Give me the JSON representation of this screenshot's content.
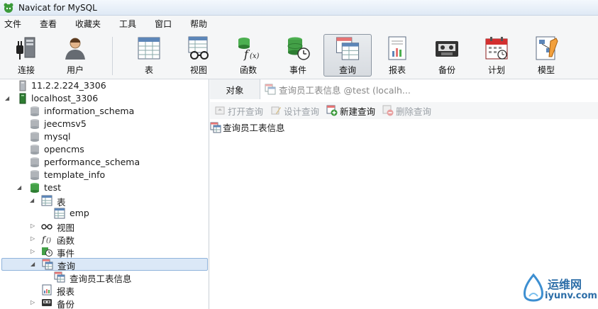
{
  "window": {
    "title": "Navicat for MySQL"
  },
  "menu": [
    "文件",
    "查看",
    "收藏夹",
    "工具",
    "窗口",
    "帮助"
  ],
  "toolbar": {
    "connect": "连接",
    "user": "用户",
    "table": "表",
    "view": "视图",
    "function": "函数",
    "event": "事件",
    "query": "查询",
    "report": "报表",
    "backup": "备份",
    "schedule": "计划",
    "model": "模型"
  },
  "tree": {
    "conn1": "11.2.2.224_3306",
    "conn2": "localhost_3306",
    "databases": [
      "information_schema",
      "jeecmsv5",
      "mysql",
      "opencms",
      "performance_schema",
      "template_info",
      "test"
    ],
    "test_children": {
      "tables": "表",
      "emp": "emp",
      "views": "视图",
      "functions": "函数",
      "events": "事件",
      "queries": "查询",
      "query_item": "查询员工表信息",
      "reports": "报表",
      "backups": "备份"
    }
  },
  "tabs": {
    "objects": "对象",
    "query_tab": "查询员工表信息 @test (localh..."
  },
  "object_toolbar": {
    "open": "打开查询",
    "design": "设计查询",
    "new": "新建查询",
    "delete": "删除查询"
  },
  "object_list": [
    "查询员工表信息"
  ],
  "watermark": {
    "cn": "运维网",
    "en": "iyunv.com"
  }
}
